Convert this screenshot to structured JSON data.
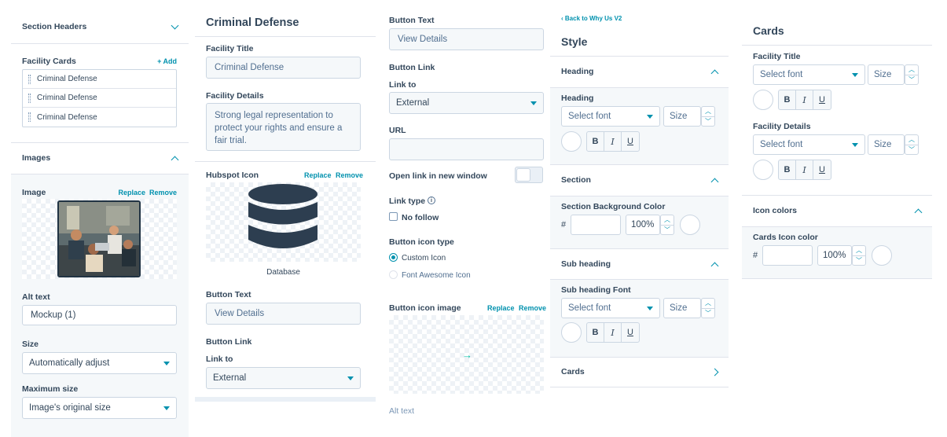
{
  "col1": {
    "section_headers": "Section Headers",
    "facility_cards": {
      "label": "Facility Cards",
      "add": "+ Add",
      "items": [
        "Criminal Defense",
        "Criminal Defense",
        "Criminal Defense"
      ]
    },
    "images": "Images",
    "image": {
      "label": "Image",
      "replace": "Replace",
      "remove": "Remove"
    },
    "alt_text": {
      "label": "Alt text",
      "value": "Mockup (1)"
    },
    "size": {
      "label": "Size",
      "value": "Automatically adjust"
    },
    "max_size": {
      "label": "Maximum size",
      "value": "Image's original size"
    }
  },
  "col2": {
    "title": "Criminal Defense",
    "facility_title": {
      "label": "Facility Title",
      "value": "Criminal Defense"
    },
    "facility_details": {
      "label": "Facility Details",
      "value": "Strong legal representation to protect your rights and ensure a fair trial."
    },
    "hubspot_icon": {
      "label": "Hubspot Icon",
      "replace": "Replace",
      "remove": "Remove",
      "caption": "Database"
    },
    "button_text": {
      "label": "Button Text",
      "value": "View Details"
    },
    "button_link": "Button Link",
    "link_to": {
      "label": "Link to",
      "value": "External"
    }
  },
  "col3": {
    "button_text": {
      "label": "Button Text",
      "value": "View Details"
    },
    "button_link": "Button Link",
    "link_to": {
      "label": "Link to",
      "value": "External"
    },
    "url": {
      "label": "URL",
      "value": ""
    },
    "open_new": "Open link in new window",
    "link_type": {
      "label": "Link type",
      "info": "i",
      "no_follow": "No follow"
    },
    "icon_type": {
      "label": "Button icon type",
      "custom": "Custom Icon",
      "font_awesome": "Font Awesome Icon"
    },
    "icon_image": {
      "label": "Button icon image",
      "replace": "Replace",
      "remove": "Remove"
    },
    "alt_text_partial": "Alt text"
  },
  "col4": {
    "back": "‹ Back to Why Us V2",
    "title": "Style",
    "heading_section": "Heading",
    "heading_label": "Heading",
    "select_font": "Select font",
    "size": "Size",
    "section": "Section",
    "section_bg": {
      "label": "Section Background Color",
      "hash": "#",
      "opacity": "100%"
    },
    "sub_heading": "Sub heading",
    "sub_heading_font": "Sub heading Font",
    "cards": "Cards",
    "bold": "B",
    "italic": "I",
    "underline": "U"
  },
  "col5": {
    "title": "Cards",
    "facility_title": "Facility Title",
    "facility_details": "Facility Details",
    "select_font": "Select font",
    "size": "Size",
    "icon_colors": "Icon colors",
    "cards_icon_color": {
      "label": "Cards Icon color",
      "hash": "#",
      "opacity": "100%"
    },
    "bold": "B",
    "italic": "I",
    "underline": "U"
  },
  "colors": {
    "accent": "#0091ae",
    "text": "#33475b",
    "border": "#cbd6e2",
    "panel": "#f5f8fa",
    "icon": "#2d3e50"
  }
}
